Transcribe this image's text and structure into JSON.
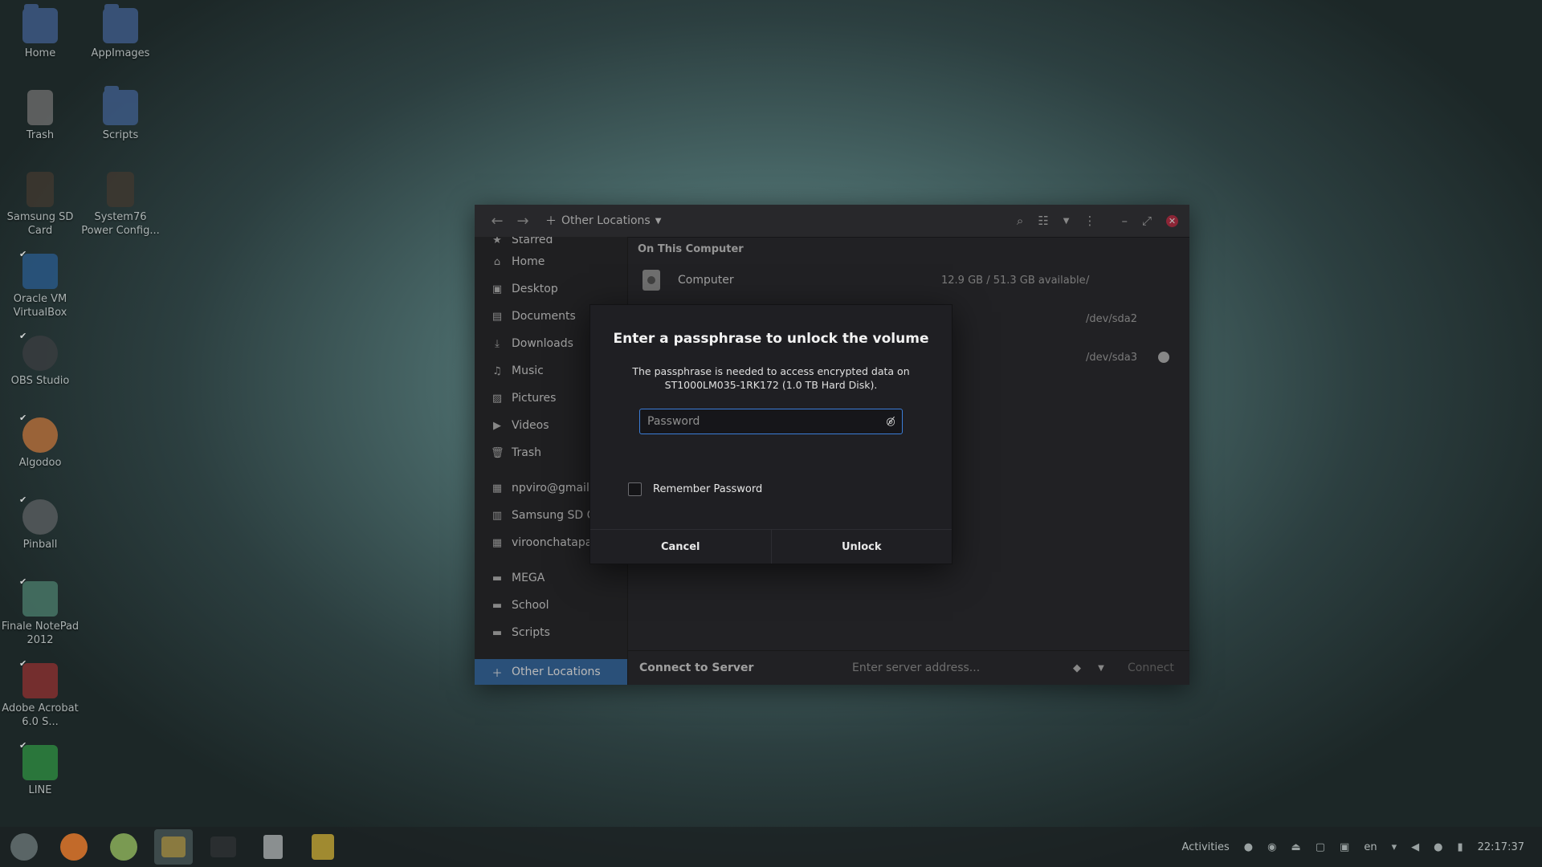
{
  "desktop": {
    "icons": [
      {
        "label": "Home",
        "icon": "home-folder-icon"
      },
      {
        "label": "AppImages",
        "icon": "folder-link-icon"
      },
      {
        "label": "Trash",
        "icon": "trash-icon"
      },
      {
        "label": "Scripts",
        "icon": "folder-link-icon"
      },
      {
        "label": "Samsung SD Card",
        "icon": "sd-card-icon"
      },
      {
        "label": "System76 Power Config...",
        "icon": "script-link-icon"
      },
      {
        "label": "Oracle VM VirtualBox",
        "icon": "virtualbox-icon"
      },
      {
        "label": "OBS Studio",
        "icon": "obs-icon"
      },
      {
        "label": "Algodoo",
        "icon": "algodoo-icon"
      },
      {
        "label": "Pinball",
        "icon": "pinball-icon"
      },
      {
        "label": "Finale NotePad 2012",
        "icon": "finale-icon"
      },
      {
        "label": "Adobe Acrobat 6.0 S...",
        "icon": "acrobat-icon"
      },
      {
        "label": "LINE",
        "icon": "line-icon"
      }
    ]
  },
  "file_manager": {
    "location_label": "Other Locations",
    "sidebar": {
      "items": [
        {
          "label": "Starred",
          "icon": "star-icon"
        },
        {
          "label": "Home",
          "icon": "home-icon"
        },
        {
          "label": "Desktop",
          "icon": "desktop-icon"
        },
        {
          "label": "Documents",
          "icon": "document-icon"
        },
        {
          "label": "Downloads",
          "icon": "download-icon"
        },
        {
          "label": "Music",
          "icon": "music-icon"
        },
        {
          "label": "Pictures",
          "icon": "picture-icon"
        },
        {
          "label": "Videos",
          "icon": "video-icon"
        },
        {
          "label": "Trash",
          "icon": "trash-icon"
        },
        {
          "label": "npviro@gmail.c",
          "icon": "network-drive-icon"
        },
        {
          "label": "Samsung SD Car",
          "icon": "drive-icon"
        },
        {
          "label": "viroonchatapani",
          "icon": "network-drive-icon"
        },
        {
          "label": "MEGA",
          "icon": "folder-icon"
        },
        {
          "label": "School",
          "icon": "folder-icon"
        },
        {
          "label": "Scripts",
          "icon": "folder-icon"
        }
      ],
      "active_item": "Other Locations"
    },
    "section_title": "On This Computer",
    "volumes": [
      {
        "name": "Computer",
        "capacity": "12.9 GB / 51.3 GB available",
        "path": "/"
      },
      {
        "name": "",
        "capacity": "",
        "path": "/dev/sda2"
      },
      {
        "name": "",
        "capacity": "",
        "path": "/dev/sda3"
      }
    ],
    "footer": {
      "title": "Connect to Server",
      "server_placeholder": "Enter server address...",
      "connect_label": "Connect"
    }
  },
  "dialog": {
    "title": "Enter a passphrase to unlock the volume",
    "message": "The passphrase is needed to access encrypted data on ST1000LM035-1RK172 (1.0 TB Hard Disk).",
    "password_placeholder": "Password",
    "password_value": "",
    "remember_label": "Remember Password",
    "remember_checked": false,
    "cancel_label": "Cancel",
    "unlock_label": "Unlock"
  },
  "taskbar": {
    "apps": [
      {
        "icon": "pop-os-icon",
        "active": false
      },
      {
        "icon": "firefox-icon",
        "active": false
      },
      {
        "icon": "chrome-icon",
        "active": false
      },
      {
        "icon": "files-icon",
        "active": true
      },
      {
        "icon": "terminal-icon",
        "active": false
      },
      {
        "icon": "clipboard-icon",
        "active": false
      },
      {
        "icon": "speaker-app-icon",
        "active": false
      }
    ],
    "activities_label": "Activities",
    "language": "en",
    "clock": "22:17:37"
  },
  "colors": {
    "accent": "#3b7dd8",
    "sidebar_active": "#3b6fa8",
    "close_button": "#c2344b"
  }
}
